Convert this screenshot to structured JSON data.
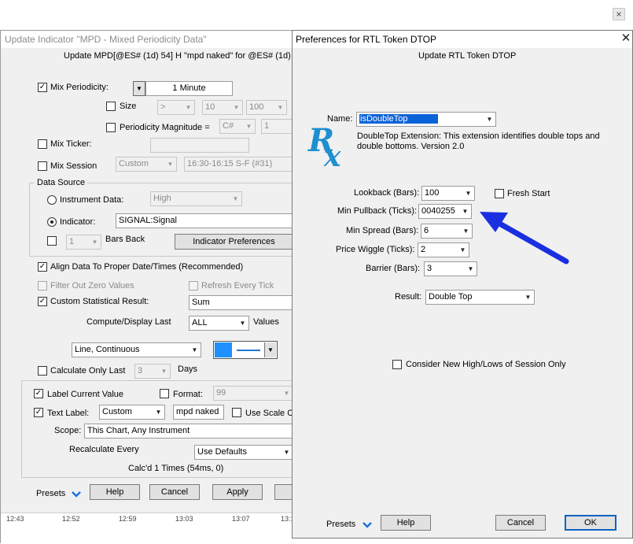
{
  "background": {
    "close_glyph": "×"
  },
  "back_window": {
    "title": "Update Indicator \"MPD - Mixed Periodicity Data\"",
    "subtitle": "Update MPD[@ES# (1d) 54] H \"mpd naked\" for @ES# (1d)",
    "mix_periodicity": {
      "label": "Mix Periodicity:",
      "checked": "✓",
      "value": "1 Minute"
    },
    "size": {
      "label": "Size",
      "op": ">",
      "val1": "10",
      "val2": "100"
    },
    "periodicity_magnitude": {
      "label": "Periodicity Magnitude =",
      "op": "C#",
      "val": "1"
    },
    "mix_ticker": {
      "label": "Mix Ticker:"
    },
    "mix_session": {
      "label": "Mix Session",
      "combo": "Custom",
      "value": "16:30-16:15 S-F (#31)"
    },
    "data_source": {
      "title": "Data Source",
      "instrument_label": "Instrument Data:",
      "instrument_value": "High",
      "indicator_label": "Indicator:",
      "indicator_value": "SIGNAL:Signal",
      "bars_back_value": "1",
      "bars_back_label": "Bars Back",
      "prefs_button": "Indicator Preferences"
    },
    "align": {
      "label": "Align Data To Proper Date/Times (Recommended)",
      "checked": "✓"
    },
    "filter_zero": {
      "label": "Filter Out Zero Values"
    },
    "refresh_tick": {
      "label": "Refresh Every Tick"
    },
    "custom_stat": {
      "label": "Custom Statistical Result:",
      "checked": "✓",
      "value": "Sum"
    },
    "compute": {
      "label": "Compute/Display Last",
      "value": "ALL",
      "suffix": "Values"
    },
    "line_style": {
      "value": "Line, Continuous",
      "color": "#1e90ff"
    },
    "calc_only": {
      "label": "Calculate Only Last",
      "value": "3",
      "suffix": "Days"
    },
    "label_current": {
      "label": "Label Current Value",
      "checked": "✓"
    },
    "format": {
      "label": "Format:",
      "value": "99"
    },
    "text_label": {
      "label": "Text Label:",
      "checked": "✓",
      "combo": "Custom",
      "value": "mpd naked"
    },
    "use_scale": {
      "label": "Use Scale Co"
    },
    "scope": {
      "label": "Scope:",
      "value": "This Chart, Any Instrument"
    },
    "recalc": {
      "label": "Recalculate Every",
      "value": "Use Defaults"
    },
    "calcd": "Calc'd 1 Times (54ms, 0)",
    "buttons": {
      "presets": "Presets",
      "help": "Help",
      "cancel": "Cancel",
      "apply": "Apply"
    },
    "timeline": [
      "12:43",
      "12:52",
      "12:59",
      "13:03",
      "13:07",
      "13:1"
    ]
  },
  "front_window": {
    "title": "Preferences for RTL Token DTOP",
    "subtitle": "Update RTL Token DTOP",
    "close_glyph": "✕",
    "name": {
      "label": "Name:",
      "value": "isDoubleTop"
    },
    "logo": {
      "text": "RX",
      "color": "#1f8fcf"
    },
    "description": "DoubleTop Extension: This extension identifies double tops and double bottoms. Version 2.0",
    "lookback": {
      "label": "Lookback (Bars):",
      "value": "100"
    },
    "fresh_start": {
      "label": "Fresh Start"
    },
    "min_pullback": {
      "label": "Min Pullback (Ticks):",
      "value": "0040255"
    },
    "min_spread": {
      "label": "Min Spread (Bars):",
      "value": "6"
    },
    "price_wiggle": {
      "label": "Price Wiggle (Ticks):",
      "value": "2"
    },
    "barrier": {
      "label": "Barrier (Bars):",
      "value": "3"
    },
    "result": {
      "label": "Result:",
      "value": "Double Top"
    },
    "consider": {
      "label": "Consider New High/Lows of Session Only"
    },
    "buttons": {
      "presets": "Presets",
      "help": "Help",
      "cancel": "Cancel",
      "ok": "OK"
    },
    "arrow_color": "#1a2fe0"
  }
}
